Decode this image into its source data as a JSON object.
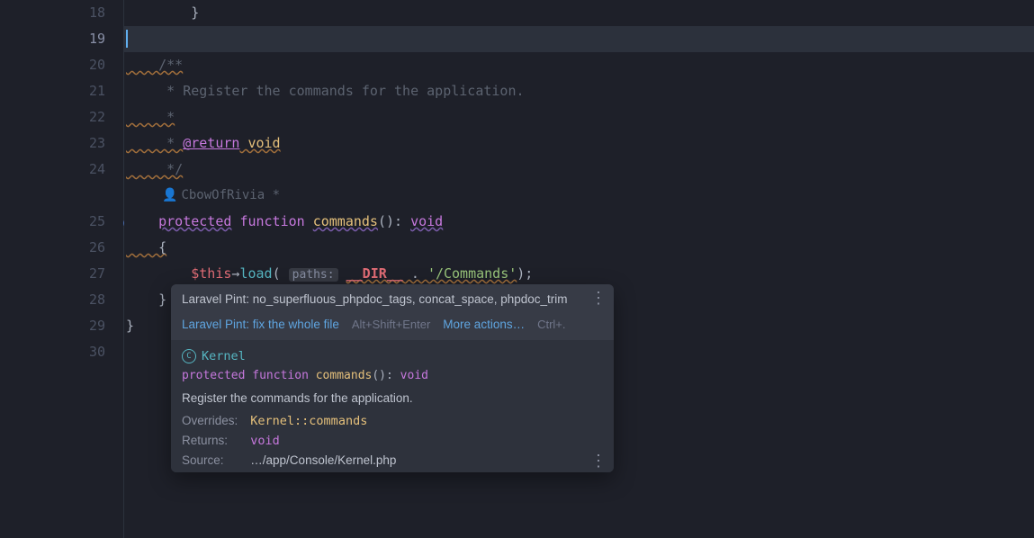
{
  "gutter": {
    "first_line": 18,
    "last_line": 30,
    "current_line": 19
  },
  "code": {
    "l18": "        }",
    "l19": "",
    "l20_a": "    /**",
    "l21_a": "     * ",
    "l21_b": "Register the commands for the application.",
    "l22": "     *",
    "l23_a": "     * ",
    "l23_tag": "@return",
    "l23_type": " void",
    "l24": "     */",
    "author_icon": "👤",
    "author_name": "CbowOfRivia *",
    "l25_kw1": "protected",
    "l25_kw2": "function",
    "l25_fn": "commands",
    "l25_parens": "()",
    "l25_colon": ": ",
    "l25_ret": "void",
    "l26": "    {",
    "l27_indent": "        ",
    "l27_this": "$this",
    "l27_arrow": "→",
    "l27_method": "load",
    "l27_open": "(",
    "l27_hint": "paths:",
    "l27_sp": " ",
    "l27_const": "__DIR__",
    "l27_concat": " . ",
    "l27_str": "'/Commands'",
    "l27_close": ");",
    "l28": "    }",
    "l29": "}"
  },
  "popup": {
    "diagnostic": "Laravel Pint: no_superfluous_phpdoc_tags, concat_space, phpdoc_trim",
    "fix_label": "Laravel Pint: fix the whole file",
    "fix_shortcut": "Alt+Shift+Enter",
    "more_actions": "More actions…",
    "more_shortcut": "Ctrl+.",
    "class_name": "Kernel",
    "sig_protected": "protected",
    "sig_function": "function",
    "sig_name": "commands",
    "sig_parens": "()",
    "sig_colon": ": ",
    "sig_ret": "void",
    "description": "Register the commands for the application.",
    "overrides_label": "Overrides:",
    "overrides_value": "Kernel::commands",
    "returns_label": "Returns:",
    "returns_value": "void",
    "source_label": "Source:",
    "source_value": "…/app/Console/Kernel.php"
  },
  "icons": {
    "more": "⋮"
  }
}
